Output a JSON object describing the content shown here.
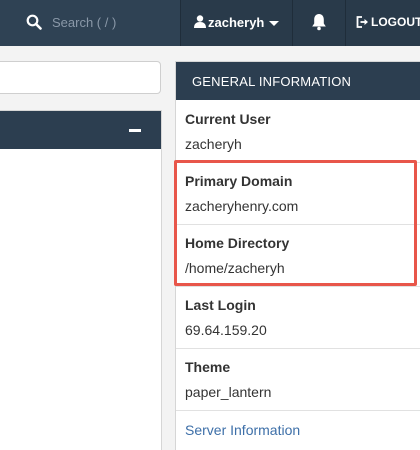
{
  "navbar": {
    "search_placeholder": "Search ( / )",
    "user_name": "zacheryh",
    "logout_label": "LOGOUT",
    "icons": [
      "search-icon",
      "user-icon",
      "caret-down-icon",
      "bell-icon",
      "logout-icon"
    ]
  },
  "left_panel": {
    "collapse_icon": "minus-icon"
  },
  "general_info": {
    "title": "GENERAL INFORMATION",
    "current_user_label": "Current User",
    "current_user_value": "zacheryh",
    "primary_domain_label": "Primary Domain",
    "primary_domain_value": "zacheryhenry.com",
    "home_directory_label": "Home Directory",
    "home_directory_value": "/home/zacheryh",
    "last_login_label": "Last Login",
    "last_login_value": "69.64.159.20",
    "theme_label": "Theme",
    "theme_value": "paper_lantern",
    "server_info_link": "Server Information"
  },
  "colors": {
    "navbar_bg": "#293a4a",
    "panel_header_bg": "#2c3e50",
    "highlight_border": "#e8564a",
    "link": "#3d6fa8"
  }
}
